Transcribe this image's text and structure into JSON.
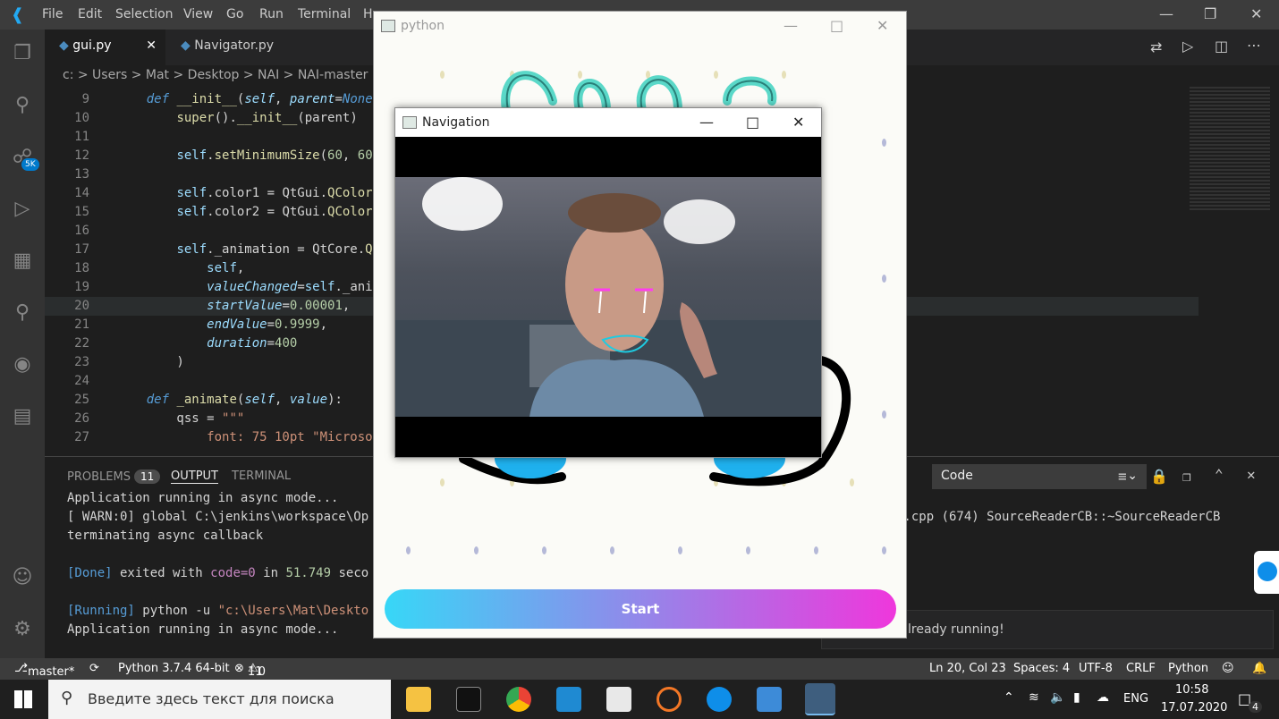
{
  "menu": [
    "File",
    "Edit",
    "Selection",
    "View",
    "Go",
    "Run",
    "Terminal",
    "H"
  ],
  "tabs": [
    {
      "label": "gui.py"
    },
    {
      "label": "Navigator.py"
    }
  ],
  "breadcrumb": "c: > Users > Mat > Desktop > NAI > NAI-master >",
  "activity_badge": "5K",
  "code": [
    {
      "n": "9",
      "html": "    <span class='kw'>def</span> <span class='fn'>__init__</span>(<span class='param'>self</span>, <span class='param'>parent</span>=<span class='kw'>None</span>"
    },
    {
      "n": "10",
      "html": "        <span class='fn'>super</span>().<span class='fn'>__init__</span>(parent)"
    },
    {
      "n": "11",
      "html": ""
    },
    {
      "n": "12",
      "html": "        <span class='sf'>self</span>.<span class='fn'>setMinimumSize</span>(<span class='num'>60</span>, <span class='num'>60</span>"
    },
    {
      "n": "13",
      "html": ""
    },
    {
      "n": "14",
      "html": "        <span class='sf'>self</span>.color1 = QtGui.<span class='fn'>QColor</span>"
    },
    {
      "n": "15",
      "html": "        <span class='sf'>self</span>.color2 = QtGui.<span class='fn'>QColor</span>"
    },
    {
      "n": "16",
      "html": ""
    },
    {
      "n": "17",
      "html": "        <span class='sf'>self</span>._animation = QtCore.<span class='fn'>Q</span>"
    },
    {
      "n": "18",
      "html": "            <span class='sf'>self</span>,"
    },
    {
      "n": "19",
      "html": "            <span class='param'>valueChanged</span>=<span class='sf'>self</span>._ani"
    },
    {
      "n": "20",
      "html": "            <span class='param'>startValue</span>=<span class='num'>0.00001</span>,"
    },
    {
      "n": "21",
      "html": "            <span class='param'>endValue</span>=<span class='num'>0.9999</span>,"
    },
    {
      "n": "22",
      "html": "            <span class='param'>duration</span>=<span class='num'>400</span>"
    },
    {
      "n": "23",
      "html": "        )"
    },
    {
      "n": "24",
      "html": ""
    },
    {
      "n": "25",
      "html": "    <span class='kw'>def</span> <span class='fn'>_animate</span>(<span class='param'>self</span>, <span class='param'>value</span>):"
    },
    {
      "n": "26",
      "html": "        qss = <span class='str'>\"\"\"</span>"
    },
    {
      "n": "27",
      "html": "<span class='str'>            font: 75 10pt \"Microso</span>"
    }
  ],
  "panel": {
    "problems_label": "PROBLEMS",
    "problems_count": "11",
    "output_label": "OUTPUT",
    "terminal_label": "TERMINAL",
    "channel": "Code",
    "lines": [
      "Application running in async mode...",
      "[ WARN:0] global C:\\jenkins\\workspace\\Op",
      "terminating async callback",
      "",
      "[Done] exited with code=0 in 51.749 seco",
      "",
      "[Running] python -u \"c:\\Users\\Mat\\Deskto",
      "Application running in async mode..."
    ],
    "warn_tail": "f.cpp (674) SourceReaderCB::~SourceReaderCB"
  },
  "notification": "lready running!",
  "status": {
    "branch": "master*",
    "python": "Python 3.7.4 64-bit",
    "errors": "11",
    "warnings": "0",
    "position": "Ln 20, Col 23",
    "spaces": "Spaces: 4",
    "encoding": "UTF-8",
    "eol": "CRLF",
    "language": "Python"
  },
  "python_window": {
    "title": "python",
    "start_label": "Start"
  },
  "nav_window": {
    "title": "Navigation"
  },
  "taskbar": {
    "search_placeholder": "Введите здесь текст для поиска",
    "lang": "ENG",
    "time": "10:58",
    "date": "17.07.2020",
    "notif_count": "4"
  }
}
